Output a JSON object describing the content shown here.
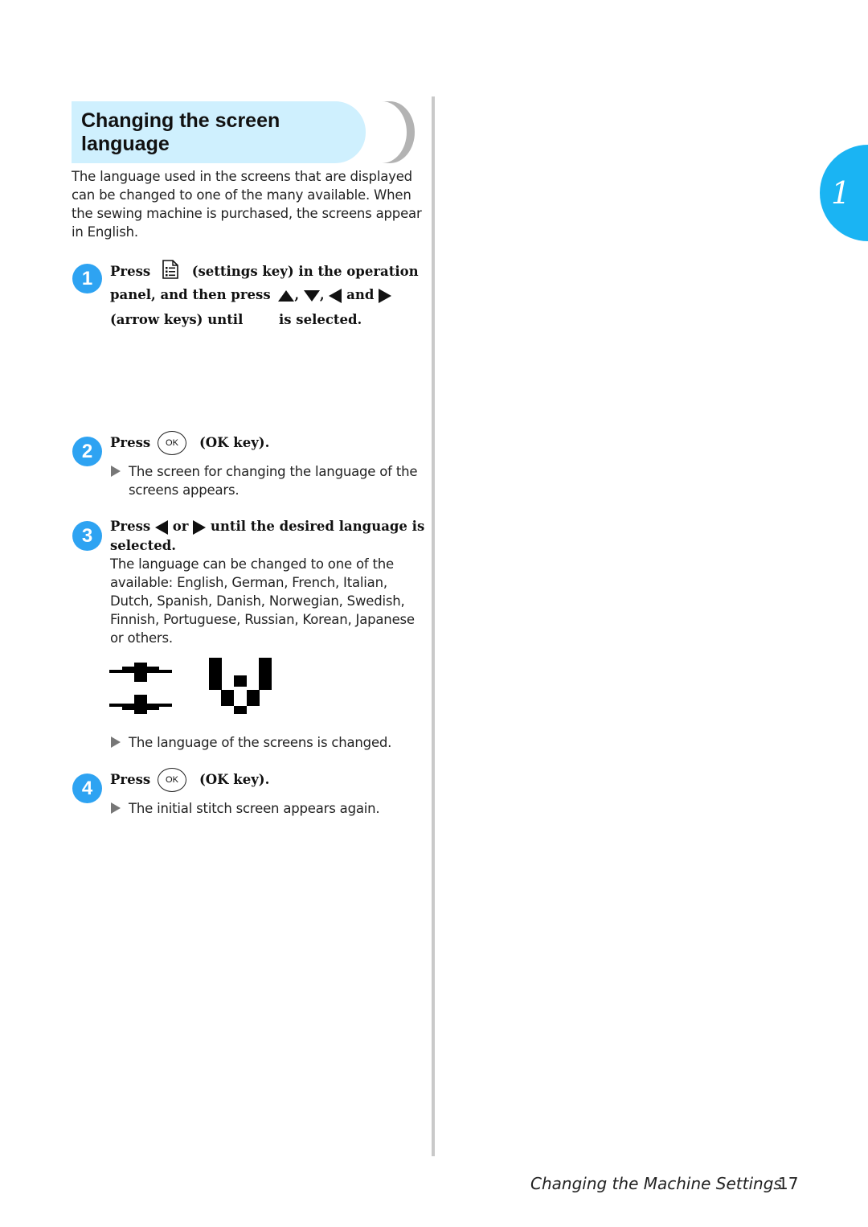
{
  "section": {
    "title_line1": "Changing the screen",
    "title_line2": "language",
    "intro": [
      "The language used in the screens that are displayed",
      "can be changed to one of the many available. When",
      "the sewing machine is purchased, the screens appear",
      "in English."
    ]
  },
  "steps": [
    {
      "number": "1",
      "press": "Press",
      "settings_key_text": "(settings key) in the operation",
      "line2_prefix": "panel, and then press",
      "comma1": ",",
      "comma2": ",",
      "and": "and",
      "line3_prefix": "(arrow keys) until",
      "line3_suffix": "is selected.",
      "icons": [
        "settings-key-icon",
        "arrow-up-icon",
        "arrow-down-icon",
        "arrow-left-icon",
        "arrow-right-icon"
      ]
    },
    {
      "number": "2",
      "press": "Press",
      "ok_key_label": "OK",
      "key_text": "(OK key).",
      "result": [
        "The screen for changing the language of the",
        "screens appears."
      ]
    },
    {
      "number": "3",
      "press": "Press",
      "or": "or",
      "instruction_suffix": "until the desired language is",
      "instruction_line2": "selected.",
      "description": [
        "The language can be changed to one of the",
        "available: English, German, French, Italian,",
        "Dutch, Spanish, Danish, Norwegian, Swedish,",
        "Finnish, Portuguese, Russian, Korean, Japanese",
        "or others."
      ],
      "result": "The language of the screens is changed."
    },
    {
      "number": "4",
      "press": "Press",
      "ok_key_label": "OK",
      "key_text": "(OK key).",
      "result": "The initial stitch screen appears again."
    }
  ],
  "chapter_tab": {
    "number": "1",
    "color": "#1ab4f3"
  },
  "footer": {
    "title": "Changing the Machine Settings",
    "page": "17"
  },
  "colors": {
    "heading_bg": "#cff0fe",
    "badge": "#2ea3f2",
    "divider": "#c9c9c9"
  }
}
